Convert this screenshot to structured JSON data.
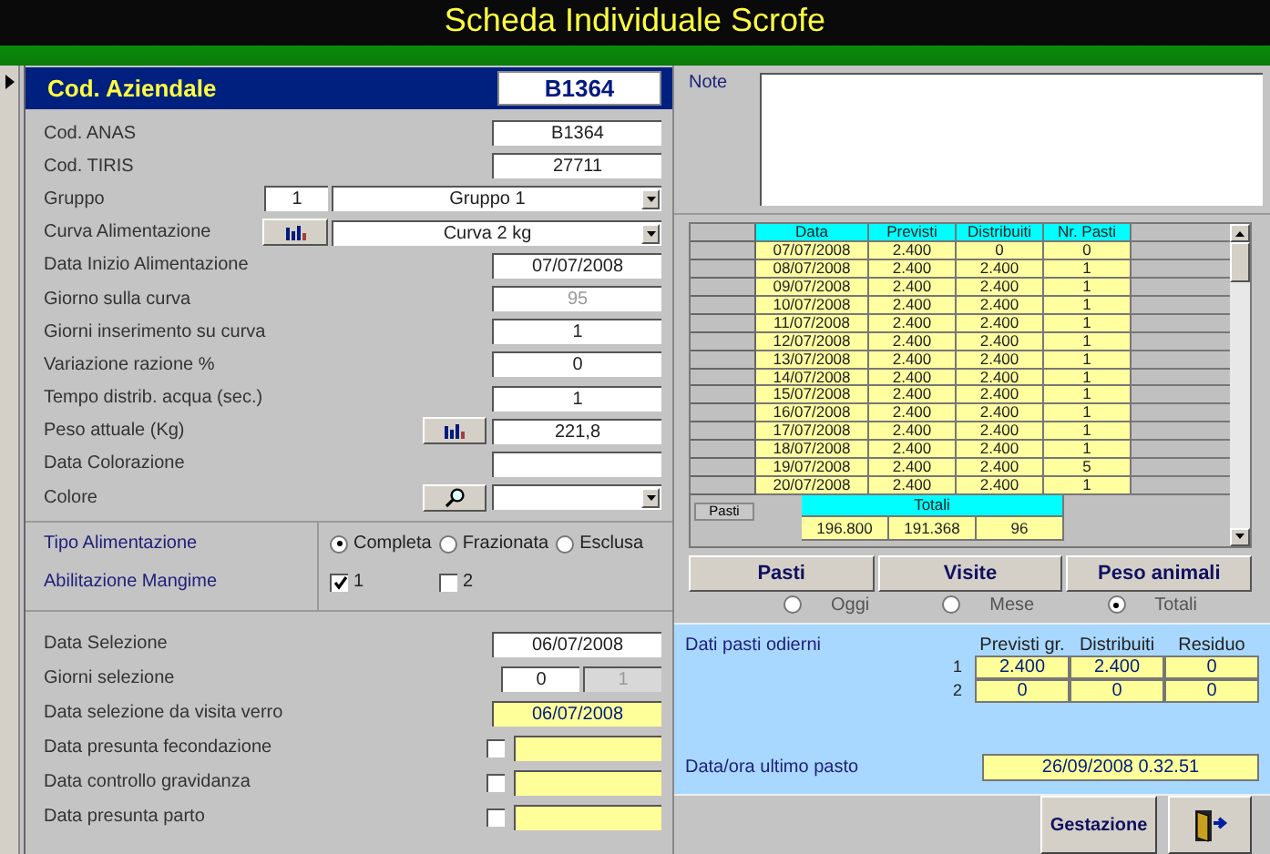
{
  "window": {
    "title": "Scheda Individuale Scrofe"
  },
  "header": {
    "label": "Cod. Aziendale",
    "value": "B1364"
  },
  "fields": [
    {
      "label": "Cod. ANAS",
      "kind": "text",
      "value": "B1364"
    },
    {
      "label": "Cod. TIRIS",
      "kind": "text",
      "value": "27711"
    },
    {
      "label": "Gruppo",
      "kind": "code_combo",
      "code": "1",
      "value": "Gruppo 1"
    },
    {
      "label": "Curva Alimentazione",
      "kind": "chart_combo",
      "value": "Curva 2 kg"
    },
    {
      "label": "Data Inizio Alimentazione",
      "kind": "text",
      "value": "07/07/2008"
    },
    {
      "label": "Giorno sulla curva",
      "kind": "disabled",
      "value": "95"
    },
    {
      "label": "Giorni inserimento su curva",
      "kind": "text",
      "value": "1"
    },
    {
      "label": "Variazione razione %",
      "kind": "text",
      "value": "0"
    },
    {
      "label": "Tempo distrib. acqua (sec.)",
      "kind": "text",
      "value": "1"
    },
    {
      "label": "Peso attuale (Kg)",
      "kind": "chart_text",
      "value": "221,8"
    },
    {
      "label": "Data Colorazione",
      "kind": "text"
    },
    {
      "label": "Colore",
      "kind": "search_combo"
    }
  ],
  "feeding": {
    "label": "Tipo Alimentazione",
    "options": [
      {
        "label": "Completa",
        "selected": true
      },
      {
        "label": "Frazionata",
        "selected": false
      },
      {
        "label": "Esclusa",
        "selected": false
      }
    ]
  },
  "feed_enable": {
    "label": "Abilitazione Mangime",
    "options": [
      {
        "label": "1",
        "checked": true
      },
      {
        "label": "2",
        "checked": false
      }
    ]
  },
  "selection": [
    {
      "label": "Data Selezione",
      "kind": "text",
      "value": "06/07/2008"
    },
    {
      "label": "Giorni selezione",
      "kind": "pair",
      "value": "0",
      "value2": "1"
    },
    {
      "label": "Data selezione da visita verro",
      "kind": "highlight",
      "value": "06/07/2008"
    },
    {
      "label": "Data presunta fecondazione",
      "kind": "check_highlight",
      "checked": false
    },
    {
      "label": "Data controllo gravidanza",
      "kind": "check_highlight",
      "checked": false
    },
    {
      "label": "Data presunta parto",
      "kind": "check_highlight",
      "checked": false
    }
  ],
  "note": {
    "label": "Note"
  },
  "table": {
    "columns": [
      "Data",
      "Previsti",
      "Distribuiti",
      "Nr. Pasti"
    ],
    "rows": [
      [
        "07/07/2008",
        "2.400",
        "0",
        "0"
      ],
      [
        "08/07/2008",
        "2.400",
        "2.400",
        "1"
      ],
      [
        "09/07/2008",
        "2.400",
        "2.400",
        "1"
      ],
      [
        "10/07/2008",
        "2.400",
        "2.400",
        "1"
      ],
      [
        "11/07/2008",
        "2.400",
        "2.400",
        "1"
      ],
      [
        "12/07/2008",
        "2.400",
        "2.400",
        "1"
      ],
      [
        "13/07/2008",
        "2.400",
        "2.400",
        "1"
      ],
      [
        "14/07/2008",
        "2.400",
        "2.400",
        "1"
      ],
      [
        "15/07/2008",
        "2.400",
        "2.400",
        "1"
      ],
      [
        "16/07/2008",
        "2.400",
        "2.400",
        "1"
      ],
      [
        "17/07/2008",
        "2.400",
        "2.400",
        "1"
      ],
      [
        "18/07/2008",
        "2.400",
        "2.400",
        "1"
      ],
      [
        "19/07/2008",
        "2.400",
        "2.400",
        "5"
      ],
      [
        "20/07/2008",
        "2.400",
        "2.400",
        "1"
      ]
    ],
    "footer_button": "Pasti",
    "totals_label": "Totali",
    "totals": [
      "196.800",
      "191.368",
      "96"
    ]
  },
  "tab_buttons": [
    "Pasti",
    "Visite",
    "Peso animali"
  ],
  "period": [
    {
      "label": "Oggi",
      "selected": false
    },
    {
      "label": "Mese",
      "selected": false
    },
    {
      "label": "Totali",
      "selected": true
    }
  ],
  "today": {
    "title": "Dati pasti odierni",
    "columns": [
      "Previsti gr.",
      "Distribuiti",
      "Residuo"
    ],
    "rows": [
      {
        "index": "1",
        "values": [
          "2.400",
          "2.400",
          "0"
        ]
      },
      {
        "index": "2",
        "values": [
          "0",
          "0",
          "0"
        ]
      }
    ],
    "last_label": "Data/ora ultimo pasto",
    "last_value": "26/09/2008 0.32.51"
  },
  "footer_buttons": [
    {
      "kind": "text",
      "label": "Gestazione"
    },
    {
      "kind": "exit"
    }
  ]
}
